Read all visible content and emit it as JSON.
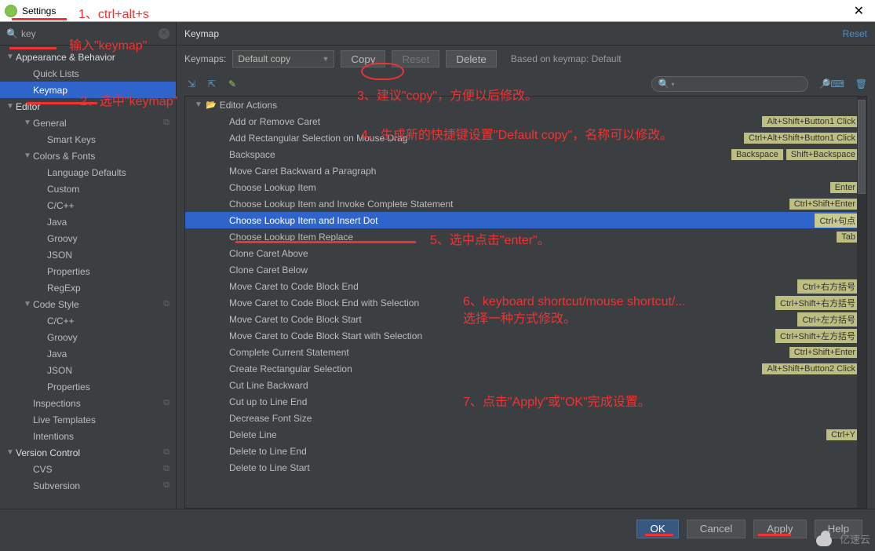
{
  "window": {
    "title": "Settings"
  },
  "sidebar": {
    "search_value": "key",
    "tree": [
      {
        "label": "Appearance & Behavior",
        "type": "section",
        "arrow": "▼"
      },
      {
        "label": "Quick Lists",
        "indent": 1
      },
      {
        "label": "Keymap",
        "indent": 1,
        "selected": true
      },
      {
        "label": "Editor",
        "type": "section",
        "arrow": "▼"
      },
      {
        "label": "General",
        "indent": 1,
        "arrow": "▼",
        "copy": true
      },
      {
        "label": "Smart Keys",
        "indent": 2
      },
      {
        "label": "Colors & Fonts",
        "indent": 1,
        "arrow": "▼"
      },
      {
        "label": "Language Defaults",
        "indent": 2
      },
      {
        "label": "Custom",
        "indent": 2
      },
      {
        "label": "C/C++",
        "indent": 2
      },
      {
        "label": "Java",
        "indent": 2
      },
      {
        "label": "Groovy",
        "indent": 2
      },
      {
        "label": "JSON",
        "indent": 2
      },
      {
        "label": "Properties",
        "indent": 2
      },
      {
        "label": "RegExp",
        "indent": 2
      },
      {
        "label": "Code Style",
        "indent": 1,
        "arrow": "▼",
        "copy": true
      },
      {
        "label": "C/C++",
        "indent": 2
      },
      {
        "label": "Groovy",
        "indent": 2
      },
      {
        "label": "Java",
        "indent": 2
      },
      {
        "label": "JSON",
        "indent": 2
      },
      {
        "label": "Properties",
        "indent": 2
      },
      {
        "label": "Inspections",
        "indent": 1,
        "copy": true
      },
      {
        "label": "Live Templates",
        "indent": 1
      },
      {
        "label": "Intentions",
        "indent": 1
      },
      {
        "label": "Version Control",
        "type": "section",
        "arrow": "▼",
        "copy": true
      },
      {
        "label": "CVS",
        "indent": 1,
        "copy": true
      },
      {
        "label": "Subversion",
        "indent": 1,
        "copy": true
      }
    ]
  },
  "panel": {
    "title": "Keymap",
    "reset": "Reset",
    "toolbar": {
      "keymaps_label": "Keymaps:",
      "keymaps_value": "Default copy",
      "copy": "Copy",
      "reset": "Reset",
      "delete": "Delete",
      "based": "Based on keymap: Default"
    },
    "group_header": "Editor Actions",
    "actions": [
      {
        "name": "Add or Remove Caret",
        "shortcuts": [
          "Alt+Shift+Button1 Click"
        ]
      },
      {
        "name": "Add Rectangular Selection on Mouse Drag",
        "shortcuts": [
          "Ctrl+Alt+Shift+Button1 Click"
        ]
      },
      {
        "name": "Backspace",
        "shortcuts": [
          "Backspace",
          "Shift+Backspace"
        ]
      },
      {
        "name": "Move Caret Backward a Paragraph",
        "shortcuts": []
      },
      {
        "name": "Choose Lookup Item",
        "shortcuts": [
          "Enter"
        ]
      },
      {
        "name": "Choose Lookup Item and Invoke Complete Statement",
        "shortcuts": [
          "Ctrl+Shift+Enter"
        ]
      },
      {
        "name": "Choose Lookup Item and Insert Dot",
        "shortcuts": [
          "Ctrl+句点"
        ],
        "selected": true
      },
      {
        "name": "Choose Lookup Item Replace",
        "shortcuts": [
          "Tab"
        ]
      },
      {
        "name": "Clone Caret Above",
        "shortcuts": []
      },
      {
        "name": "Clone Caret Below",
        "shortcuts": []
      },
      {
        "name": "Move Caret to Code Block End",
        "shortcuts": [
          "Ctrl+右方括号"
        ]
      },
      {
        "name": "Move Caret to Code Block End with Selection",
        "shortcuts": [
          "Ctrl+Shift+右方括号"
        ]
      },
      {
        "name": "Move Caret to Code Block Start",
        "shortcuts": [
          "Ctrl+左方括号"
        ]
      },
      {
        "name": "Move Caret to Code Block Start with Selection",
        "shortcuts": [
          "Ctrl+Shift+左方括号"
        ]
      },
      {
        "name": "Complete Current Statement",
        "shortcuts": [
          "Ctrl+Shift+Enter"
        ]
      },
      {
        "name": "Create Rectangular Selection",
        "shortcuts": [
          "Alt+Shift+Button2 Click"
        ]
      },
      {
        "name": "Cut Line Backward",
        "shortcuts": []
      },
      {
        "name": "Cut up to Line End",
        "shortcuts": []
      },
      {
        "name": "Decrease Font Size",
        "shortcuts": []
      },
      {
        "name": "Delete Line",
        "shortcuts": [
          "Ctrl+Y"
        ]
      },
      {
        "name": "Delete to Line End",
        "shortcuts": []
      },
      {
        "name": "Delete to Line Start",
        "shortcuts": []
      }
    ]
  },
  "footer": {
    "ok": "OK",
    "cancel": "Cancel",
    "apply": "Apply",
    "help": "Help"
  },
  "annotations": {
    "a1": "1、ctrl+alt+s",
    "a2_pre": "输入\"keymap\"",
    "a2": "2、选中\"keymap\"",
    "a3": "3、建议\"copy\"，方便以后修改。",
    "a4": "4、生成新的快捷键设置\"Default copy\"，名称可以修改。",
    "a5": "5、选中点击\"enter\"。",
    "a6a": "6、keyboard shortcut/mouse shortcut/...",
    "a6b": "选择一种方式修改。",
    "a7": "7、点击\"Apply\"或\"OK\"完成设置。"
  },
  "watermark": "亿速云"
}
